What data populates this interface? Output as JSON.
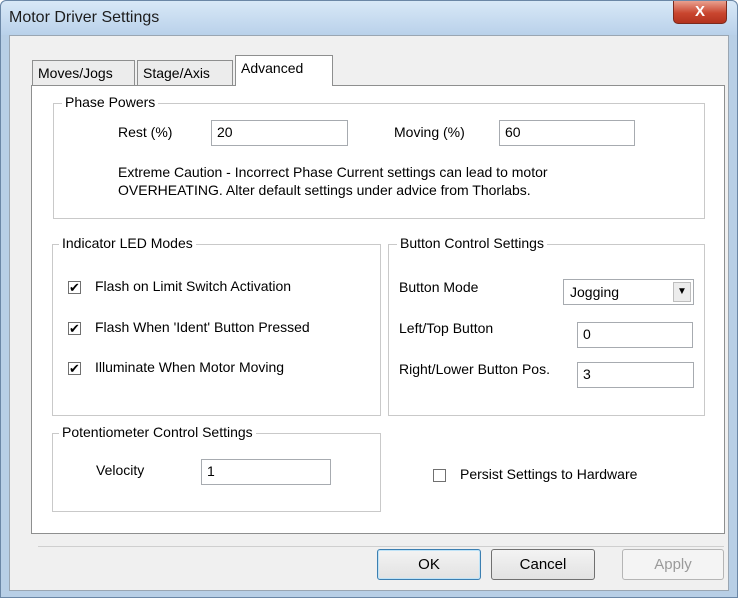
{
  "window": {
    "title": "Motor Driver Settings",
    "close_label": "X"
  },
  "tabs": [
    {
      "label": "Moves/Jogs"
    },
    {
      "label": "Stage/Axis"
    },
    {
      "label": "Advanced"
    }
  ],
  "phase_powers": {
    "legend": "Phase Powers",
    "rest_label": "Rest (%)",
    "rest_value": "20",
    "moving_label": "Moving (%)",
    "moving_value": "60",
    "caution_line1": "Extreme Caution - Incorrect Phase Current settings can lead to motor",
    "caution_line2": "OVERHEATING. Alter default settings under advice from Thorlabs."
  },
  "indicator_led": {
    "legend": "Indicator LED Modes",
    "items": [
      {
        "label": "Flash on Limit Switch Activation",
        "checked": "✔"
      },
      {
        "label": "Flash When 'Ident' Button Pressed",
        "checked": "✔"
      },
      {
        "label": "Illuminate When Motor Moving",
        "checked": "✔"
      }
    ]
  },
  "button_control": {
    "legend": "Button Control Settings",
    "mode_label": "Button Mode",
    "mode_value": "Jogging",
    "left_top_label": "Left/Top Button",
    "left_top_value": "0",
    "right_lower_label": "Right/Lower Button Pos.",
    "right_lower_value": "3"
  },
  "potentiometer": {
    "legend": "Potentiometer Control Settings",
    "velocity_label": "Velocity",
    "velocity_value": "1"
  },
  "persist": {
    "label": "Persist Settings to Hardware",
    "checked": ""
  },
  "buttons": {
    "ok": "OK",
    "cancel": "Cancel",
    "apply": "Apply"
  }
}
